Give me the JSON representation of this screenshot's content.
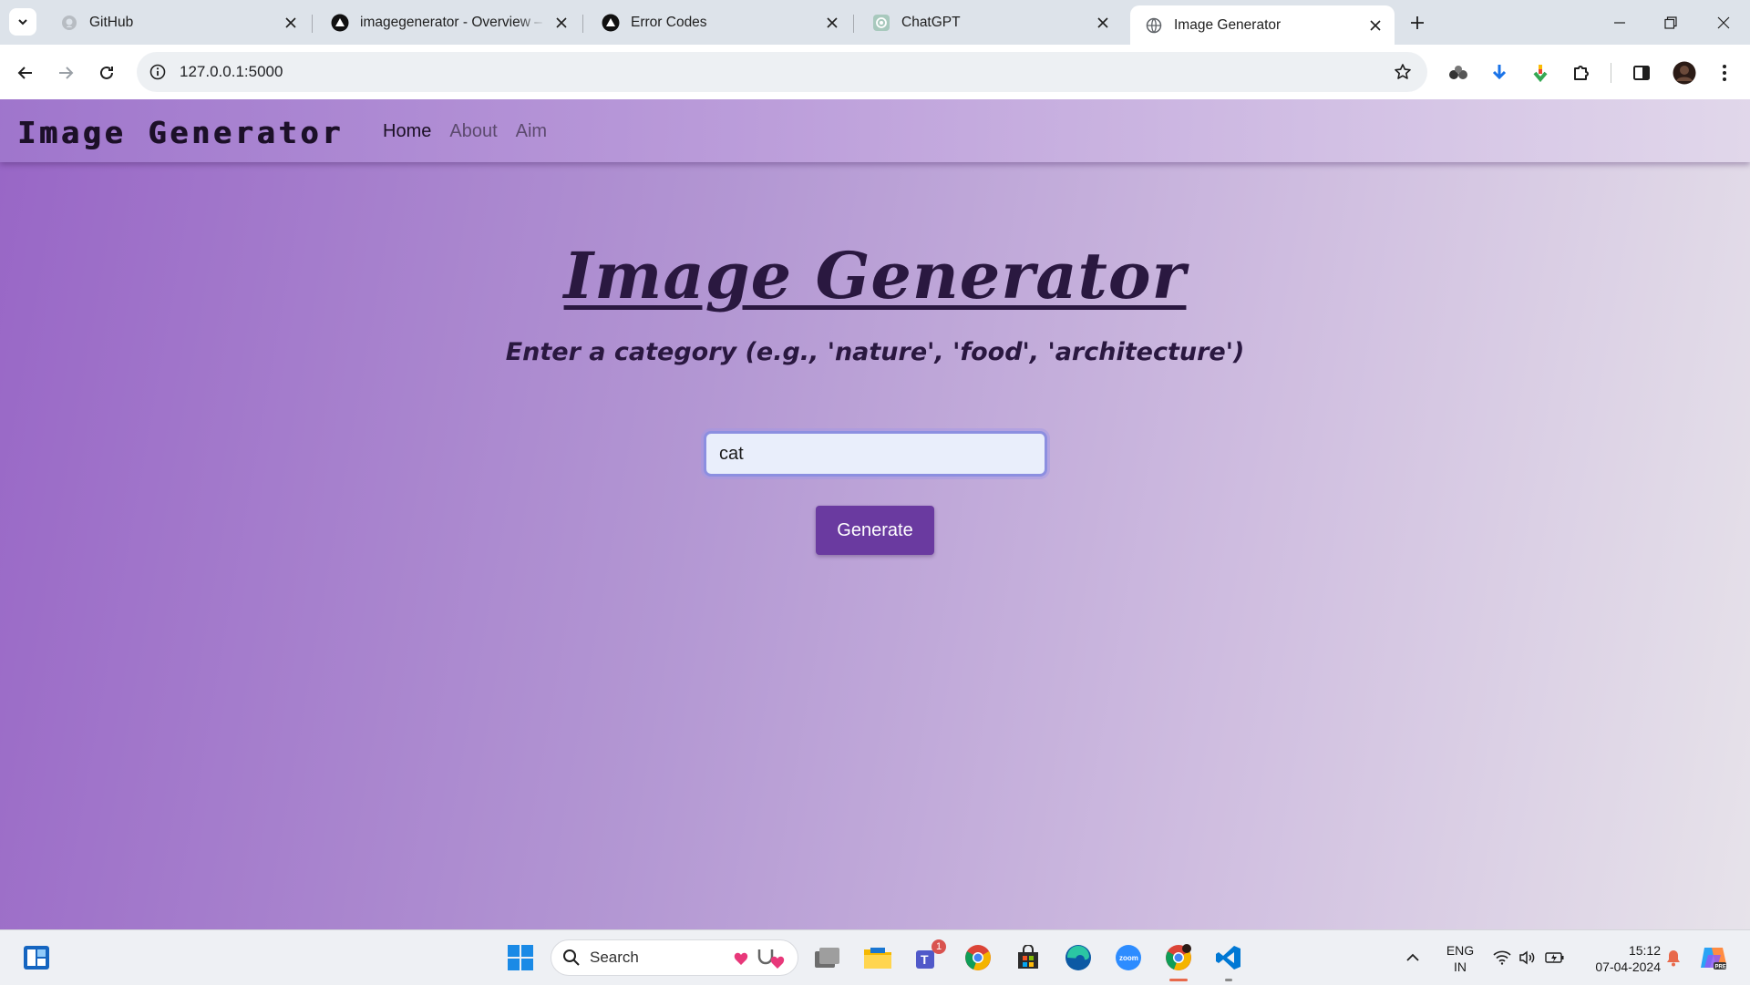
{
  "browser": {
    "tabs": [
      {
        "title": "GitHub",
        "icon": "github-icon",
        "active": false
      },
      {
        "title": "imagegenerator - Overview – Vercel",
        "icon": "vercel-icon",
        "active": false
      },
      {
        "title": "Error Codes",
        "icon": "vercel-icon",
        "active": false
      },
      {
        "title": "ChatGPT",
        "icon": "chatgpt-icon",
        "active": false
      },
      {
        "title": "Image Generator",
        "icon": "globe-icon",
        "active": true
      }
    ],
    "url": "127.0.0.1:5000"
  },
  "page": {
    "navbar": {
      "brand": "Image Generator",
      "links": [
        "Home",
        "About",
        "Aim"
      ]
    },
    "hero_title": "Image Generator",
    "subtitle": "Enter a category (e.g., 'nature', 'food', 'architecture')",
    "input_value": "cat",
    "button_label": "Generate"
  },
  "taskbar": {
    "search_label": "Search",
    "teams_badge": "1",
    "lang_top": "ENG",
    "lang_bottom": "IN",
    "time": "15:12",
    "date": "07-04-2024"
  },
  "colors": {
    "accent_button": "#6a3aa0",
    "gradient_left": "#9866c6",
    "gradient_right": "#e7e3ea",
    "heading_text": "#2a1840"
  }
}
